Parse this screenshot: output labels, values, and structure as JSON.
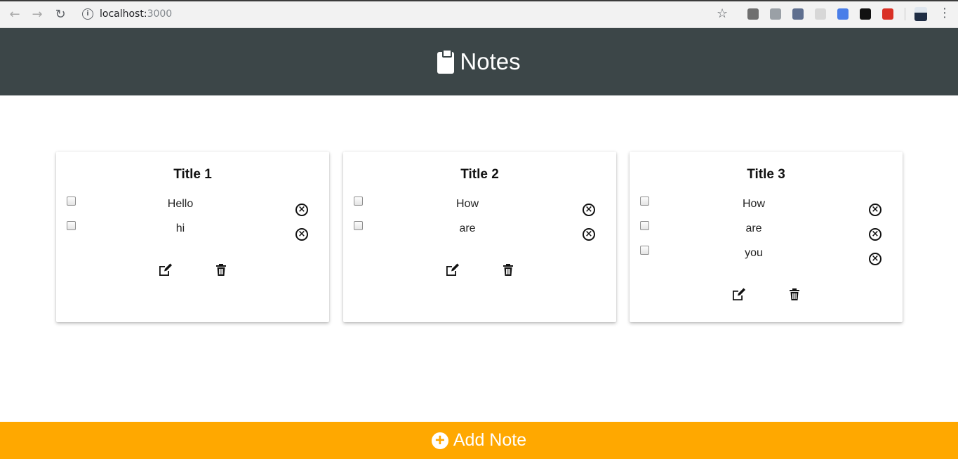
{
  "browser": {
    "back_glyph": "←",
    "forward_glyph": "→",
    "reload_glyph": "↻",
    "info_glyph": "i",
    "url_host": "localhost:",
    "url_port": "3000",
    "star_glyph": "☆",
    "menu_glyph": "⋮",
    "extensions": [
      {
        "name": "extension-circle-icon",
        "color": "#6f6f6f"
      },
      {
        "name": "extension-bike-icon",
        "color": "#9aa0a6"
      },
      {
        "name": "extension-infinity-icon",
        "color": "#5f6f8f"
      },
      {
        "name": "extension-timer-icon",
        "color": "#d7d7d7"
      },
      {
        "name": "google-translate-icon",
        "color": "#4a7ee8"
      },
      {
        "name": "extension-gnome-icon",
        "color": "#111111"
      },
      {
        "name": "extension-red-icon",
        "color": "#d93025"
      }
    ]
  },
  "header": {
    "title": "Notes",
    "icon": "clipboard-icon",
    "background": "#3c4648"
  },
  "notes": [
    {
      "title": "Title 1",
      "items": [
        {
          "text": "Hello",
          "checked": false
        },
        {
          "text": "hi",
          "checked": false
        }
      ]
    },
    {
      "title": "Title 2",
      "items": [
        {
          "text": "How",
          "checked": false
        },
        {
          "text": "are",
          "checked": false
        }
      ]
    },
    {
      "title": "Title 3",
      "items": [
        {
          "text": "How",
          "checked": false
        },
        {
          "text": "are",
          "checked": false
        },
        {
          "text": "you",
          "checked": false
        }
      ]
    }
  ],
  "item_remove_glyph": "×",
  "footer": {
    "label": "Add Note",
    "plus_glyph": "+",
    "background": "#ffa800"
  }
}
